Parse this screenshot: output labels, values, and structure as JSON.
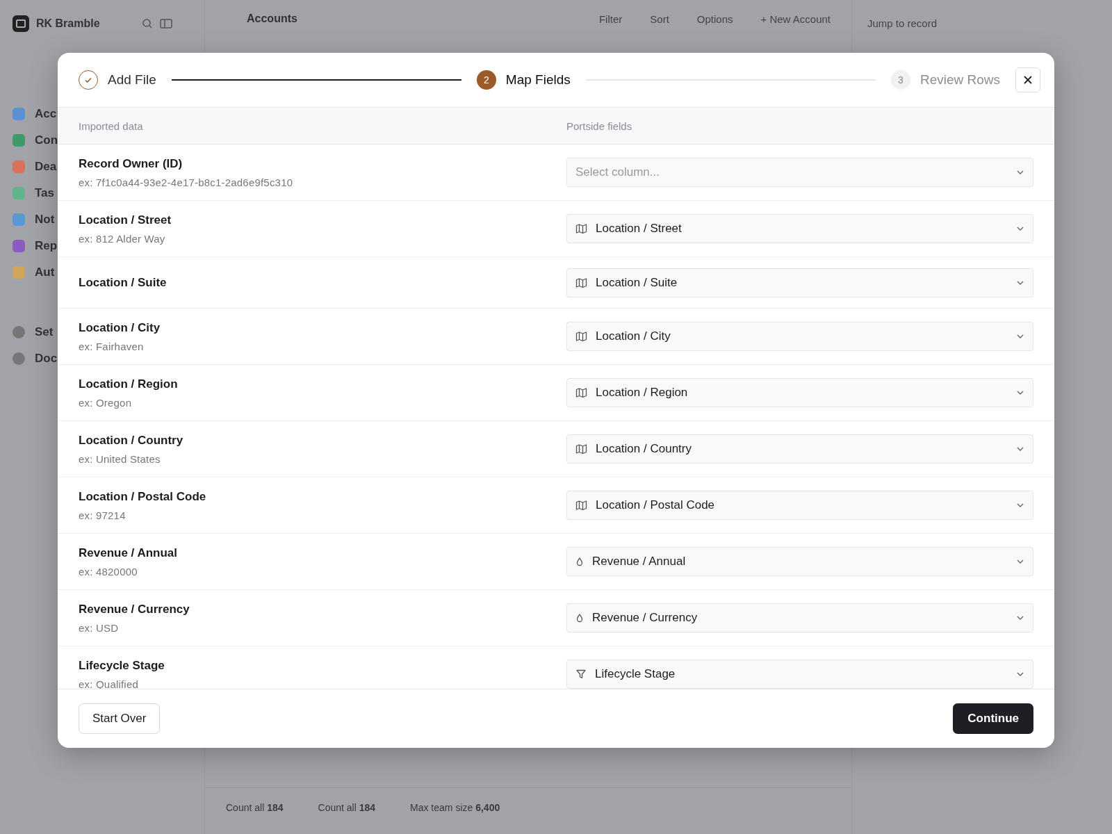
{
  "app": {
    "workspace": "RK Bramble",
    "page_title": "Accounts",
    "toolbar": [
      "Filter",
      "Sort",
      "Options",
      "+ New Account"
    ],
    "jump": {
      "placeholder": "Jump to record"
    },
    "sidebar": [
      {
        "label": "Acc",
        "color": "#5b8fd6"
      },
      {
        "label": "Con",
        "color": "#3f9a6a"
      },
      {
        "label": "Dea",
        "color": "#d8705a"
      },
      {
        "label": "Tas",
        "color": "#5fb58a"
      },
      {
        "label": "Not",
        "color": "#5b96d6"
      },
      {
        "label": "Rep",
        "color": "#8a5cc2"
      },
      {
        "label": "Aut",
        "color": "#d2a55a"
      }
    ],
    "sidebar_other": [
      {
        "label": "Set"
      },
      {
        "label": "Doc"
      }
    ],
    "footer": [
      {
        "label": "Count all",
        "value": "184"
      },
      {
        "label": "Count all",
        "value": "184"
      },
      {
        "label": "Max team size",
        "value": "6,400"
      }
    ]
  },
  "modal": {
    "steps": [
      {
        "label": "Add File",
        "completed": true,
        "selected": false
      },
      {
        "number": "2",
        "label": "Map Fields",
        "completed": false,
        "selected": true
      },
      {
        "number": "3",
        "label": "Review Rows",
        "completed": false,
        "selected": false
      }
    ],
    "columns": [
      "Imported data",
      "Portside fields"
    ],
    "rows": [
      {
        "label": "Record Owner (ID)",
        "example": "ex: 7f1c0a44-93e2-4e17-b8c1-2ad6e9f5c310",
        "select": {
          "placeholder": "Select column..."
        }
      },
      {
        "label": "Location / Street",
        "example": "ex: 812 Alder Way",
        "select": {
          "value": "Location / Street",
          "kind": "map"
        }
      },
      {
        "label": "Location / Suite",
        "select": {
          "value": "Location / Suite",
          "kind": "map"
        }
      },
      {
        "label": "Location / City",
        "example": "ex: Fairhaven",
        "select": {
          "value": "Location / City",
          "kind": "map"
        }
      },
      {
        "label": "Location / Region",
        "example": "ex: Oregon",
        "select": {
          "value": "Location / Region",
          "kind": "map"
        }
      },
      {
        "label": "Location / Country",
        "example": "ex: United States",
        "select": {
          "value": "Location / Country",
          "kind": "map"
        }
      },
      {
        "label": "Location / Postal Code",
        "example": "ex: 97214",
        "select": {
          "value": "Location / Postal Code",
          "kind": "map"
        }
      },
      {
        "label": "Revenue / Annual",
        "example": "ex: 4820000",
        "select": {
          "value": "Revenue / Annual",
          "kind": "drop"
        }
      },
      {
        "label": "Revenue / Currency",
        "example": "ex: USD",
        "select": {
          "value": "Revenue / Currency",
          "kind": "drop"
        }
      },
      {
        "label": "Lifecycle Stage",
        "example": "ex: Qualified",
        "select": {
          "value": "Lifecycle Stage",
          "kind": "funnel"
        }
      }
    ],
    "buttons": {
      "secondary": "Start Over",
      "primary": "Continue"
    }
  }
}
